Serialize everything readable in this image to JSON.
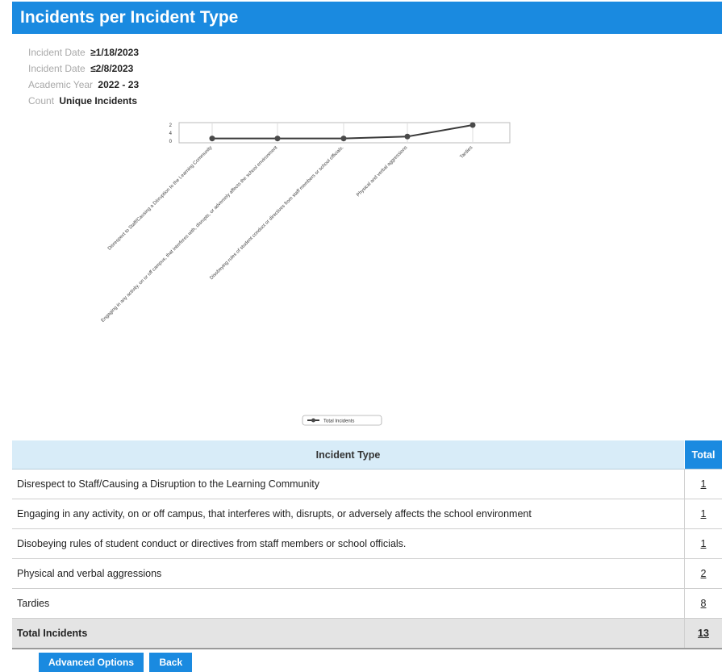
{
  "header": {
    "title": "Incidents per Incident Type"
  },
  "criteria": [
    {
      "label": "Incident Date",
      "value": "≥1/18/2023"
    },
    {
      "label": "Incident Date",
      "value": "≤2/8/2023"
    },
    {
      "label": "Academic Year",
      "value": "2022 - 23"
    },
    {
      "label": "Count",
      "value": "Unique Incidents"
    }
  ],
  "chart_data": {
    "type": "line",
    "categories": [
      "Disrespect to Staff/Causing a Disruption to the Learning Community",
      "Engaging in any activity, on or off campus, that interferes with, disrupts, or adversely affects the school environment",
      "Disobeying rules of student conduct or directives from staff members or school officials.",
      "Physical and verbal aggressions",
      "Tardies"
    ],
    "series": [
      {
        "name": "Total Incidents",
        "values": [
          1,
          1,
          1,
          2,
          8
        ]
      }
    ],
    "yticks": [
      "2",
      "4",
      "0"
    ],
    "ylim": [
      0,
      8
    ],
    "grid": true,
    "legend": "bottom-center",
    "colors": {
      "line": "#3a3a3a",
      "marker": "#4a4a4a",
      "grid": "#dddddd"
    }
  },
  "table": {
    "headers": {
      "type": "Incident Type",
      "total": "Total"
    },
    "rows": [
      {
        "type": "Disrespect to Staff/Causing a Disruption to the Learning Community",
        "total": "1"
      },
      {
        "type": "Engaging in any activity, on or off campus, that interferes with, disrupts, or adversely affects the school environment",
        "total": "1"
      },
      {
        "type": "Disobeying rules of student conduct or directives from staff members or school officials.",
        "total": "1"
      },
      {
        "type": "Physical and verbal aggressions",
        "total": "2"
      },
      {
        "type": "Tardies",
        "total": "8"
      }
    ],
    "total_row": {
      "label": "Total Incidents",
      "total": "13"
    }
  },
  "buttons": {
    "advanced": "Advanced Options",
    "back": "Back"
  },
  "colors": {
    "accent": "#1a8ae0",
    "header_row": "#d8ecf8",
    "total_row": "#e4e4e4"
  }
}
